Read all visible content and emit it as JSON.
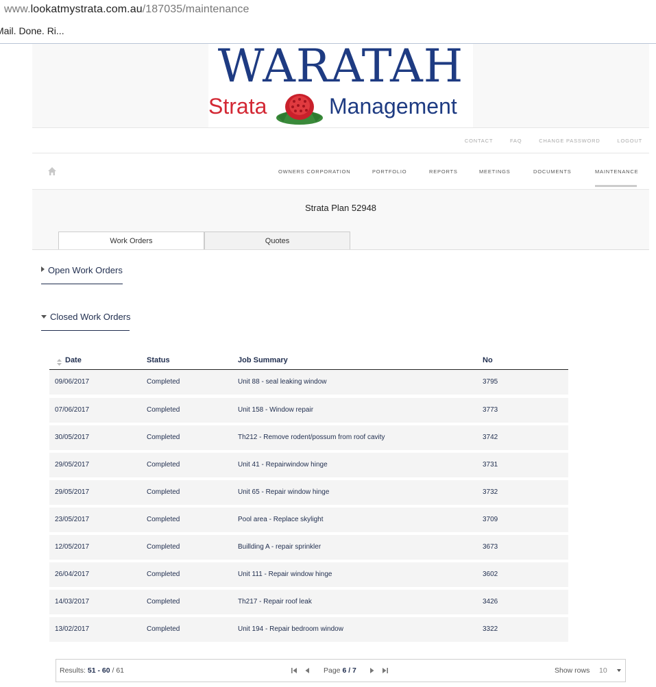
{
  "browser": {
    "url_prefix": "www.",
    "url_host": "lookatmystrata.com.au",
    "url_path": "/187035/maintenance",
    "bookmark_text": "Mail. Done. Ri..."
  },
  "logo": {
    "line1": "WARATAH",
    "word_left": "Strata",
    "word_right": "Management"
  },
  "utility_nav": [
    "CONTACT",
    "FAQ",
    "CHANGE PASSWORD",
    "LOGOUT"
  ],
  "main_nav": [
    "OWNERS CORPORATION",
    "PORTFOLIO",
    "REPORTS",
    "MEETINGS",
    "DOCUMENTS",
    "MAINTENANCE"
  ],
  "main_nav_active": "MAINTENANCE",
  "plan_title": "Strata Plan 52948",
  "tabs": [
    {
      "label": "Work Orders",
      "active": true
    },
    {
      "label": "Quotes",
      "active": false
    }
  ],
  "sections": {
    "open": "Open Work Orders",
    "closed": "Closed Work Orders"
  },
  "table": {
    "columns": [
      "Date",
      "Status",
      "Job Summary",
      "No"
    ],
    "rows": [
      [
        "09/06/2017",
        "Completed",
        "Unit 88 - seal leaking window",
        "3795"
      ],
      [
        "07/06/2017",
        "Completed",
        "Unit 158 - Window repair",
        "3773"
      ],
      [
        "30/05/2017",
        "Completed",
        "Th212 - Remove rodent/possum from roof cavity",
        "3742"
      ],
      [
        "29/05/2017",
        "Completed",
        "Unit 41 - Repairwindow hinge",
        "3731"
      ],
      [
        "29/05/2017",
        "Completed",
        "Unit 65 - Repair window hinge",
        "3732"
      ],
      [
        "23/05/2017",
        "Completed",
        "Pool area - Replace skylight",
        "3709"
      ],
      [
        "12/05/2017",
        "Completed",
        "Buillding A - repair sprinkler",
        "3673"
      ],
      [
        "26/04/2017",
        "Completed",
        "Unit 111 - Repair window hinge",
        "3602"
      ],
      [
        "14/03/2017",
        "Completed",
        "Th217 - Repair roof leak",
        "3426"
      ],
      [
        "13/02/2017",
        "Completed",
        "Unit 194 - Repair bedroom window",
        "3322"
      ]
    ]
  },
  "pager": {
    "results_label": "Results:",
    "results_range": "51 - 60",
    "results_total": "/ 61",
    "page_label": "Page",
    "page_value": "6 / 7",
    "show_rows_label": "Show rows",
    "rows_value": "10"
  },
  "colors": {
    "brand_blue": "#1e3b82",
    "brand_red": "#d32834",
    "text_navy": "#1f2d4e"
  }
}
